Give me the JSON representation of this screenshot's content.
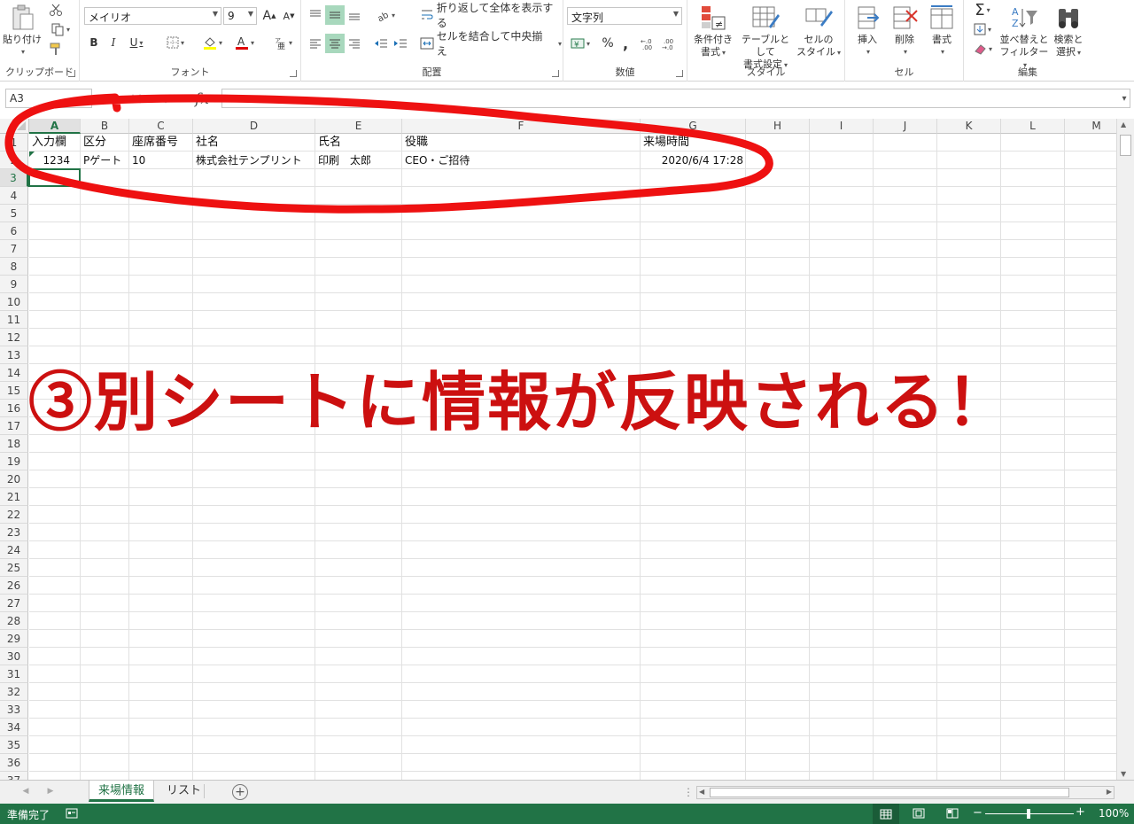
{
  "ribbon": {
    "clipboard": {
      "label": "クリップボード",
      "paste_label": "貼り付け"
    },
    "font": {
      "label": "フォント",
      "font_name": "メイリオ",
      "font_size": "9",
      "grow": "A",
      "shrink": "A",
      "bold": "B",
      "italic": "I",
      "underline": "U"
    },
    "alignment": {
      "label": "配置",
      "wrap_label": "折り返して全体を表示する",
      "merge_label": "セルを結合して中央揃え"
    },
    "number": {
      "label": "数値",
      "format": "文字列",
      "percent": "%",
      "comma": ","
    },
    "styles": {
      "label": "スタイル",
      "conditional": [
        "条件付き",
        "書式"
      ],
      "table": [
        "テーブルとして",
        "書式設定"
      ],
      "cell_styles": [
        "セルの",
        "スタイル"
      ]
    },
    "cells": {
      "label": "セル",
      "insert": "挿入",
      "delete": "削除",
      "format": "書式"
    },
    "editing": {
      "label": "編集",
      "sort": [
        "並べ替えと",
        "フィルター"
      ],
      "find": [
        "検索と",
        "選択"
      ]
    }
  },
  "formula_bar": {
    "name_box": "A3",
    "fx": "fx",
    "value": ""
  },
  "grid": {
    "columns": [
      "A",
      "B",
      "C",
      "D",
      "E",
      "F",
      "G",
      "H",
      "I",
      "J",
      "K",
      "L",
      "M"
    ],
    "selected_column": "A",
    "selected_row": 3,
    "row_count": 37,
    "rows": {
      "1": {
        "A": "入力欄",
        "B": "区分",
        "C": "座席番号",
        "D": "社名",
        "E": "氏名",
        "F": "役職",
        "G": "来場時間"
      },
      "2": {
        "A": "1234",
        "B": "Pゲート",
        "C": "10",
        "D": "株式会社テンプリント",
        "E": "印刷　太郎",
        "F": "CEO・ご招待",
        "G": "2020/6/4 17:28"
      }
    }
  },
  "sheet_tabs": [
    {
      "label": "来場情報",
      "active": true
    },
    {
      "label": "リスト",
      "active": false
    }
  ],
  "status_bar": {
    "ready": "準備完了",
    "zoom": "100%"
  },
  "annotation": {
    "text": "③別シートに情報が反映される！",
    "color": "#cc1010"
  },
  "colors": {
    "accent": "#217346",
    "annotation": "#ee1111"
  }
}
